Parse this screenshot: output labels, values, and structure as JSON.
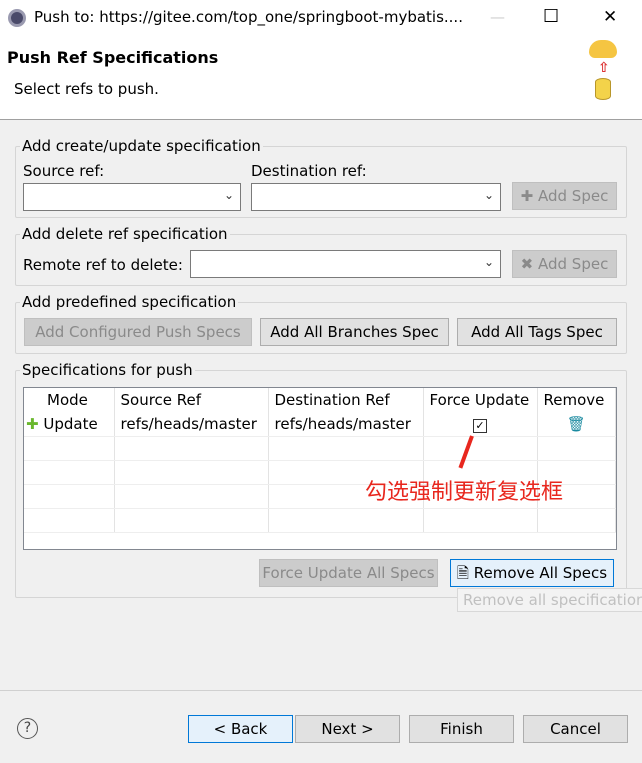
{
  "window": {
    "title": "Push to: https://gitee.com/top_one/springboot-mybatis....",
    "minimize": "—",
    "maximize": "☐",
    "close": "✕"
  },
  "header": {
    "title": "Push Ref Specifications",
    "subtitle": "Select refs to push."
  },
  "create": {
    "legend": "Add create/update specification",
    "source_label": "Source ref:",
    "dest_label": "Destination ref:",
    "source_value": "",
    "dest_value": "",
    "add_spec": "Add Spec"
  },
  "delete": {
    "legend": "Add delete ref specification",
    "remote_label": "Remote ref to delete:",
    "remote_value": "",
    "add_spec": "Add Spec"
  },
  "predefined": {
    "legend": "Add predefined specification",
    "configured": "Add Configured Push Specs",
    "branches": "Add All Branches Spec",
    "tags": "Add All Tags Spec"
  },
  "specs": {
    "legend": "Specifications for push",
    "columns": [
      "Mode",
      "Source Ref",
      "Destination Ref",
      "Force Update",
      "Remove"
    ],
    "rows": [
      {
        "mode": "Update",
        "source": "refs/heads/master",
        "dest": "refs/heads/master",
        "force": true
      }
    ],
    "annotation": "勾选强制更新复选框",
    "annotation_color": "#e8271e",
    "force_all": "Force Update All Specs",
    "remove_all": "Remove All Specs",
    "tooltip": "Remove all specifications"
  },
  "footer": {
    "back": "< Back",
    "next": "Next >",
    "finish": "Finish",
    "cancel": "Cancel"
  }
}
